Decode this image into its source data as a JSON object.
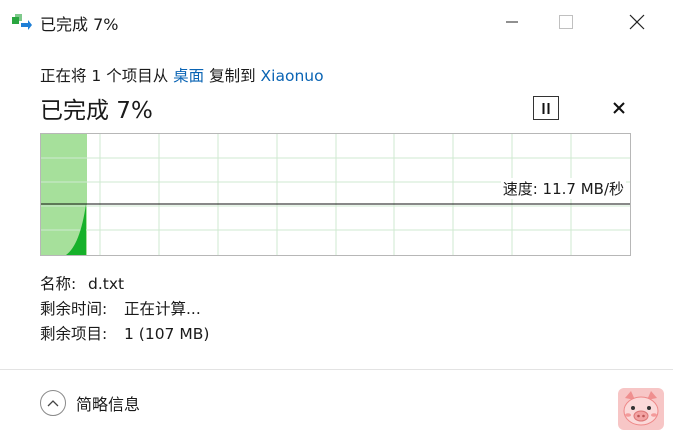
{
  "window": {
    "title": "已完成 7%",
    "icon": "copy-files-icon",
    "controls": [
      "minimize-icon",
      "maximize-icon",
      "close-icon"
    ]
  },
  "transfer": {
    "prefix": "正在将 1 个项目从 ",
    "source": "桌面",
    "middle": " 复制到 ",
    "destination": "Xiaonuo"
  },
  "status": {
    "headline": "已完成 7%",
    "progress_percent": 7
  },
  "actions": {
    "pause_icon": "pause-icon",
    "cancel_icon": "close-icon"
  },
  "chart_data": {
    "type": "area",
    "speed_label": "速度: 11.7 MB/秒",
    "progress_percent": 7
  },
  "details": {
    "name_label": "名称:",
    "name_value": "d.txt",
    "time_label": "剩余时间:",
    "time_value": "正在计算...",
    "items_label": "剩余项目:",
    "items_value": "1 (107 MB)"
  },
  "footer": {
    "toggle_label": "简略信息",
    "toggle_icon": "chevron-up-icon",
    "mascot_icon": "pig-face-icon"
  },
  "colors": {
    "link": "#0a64b4",
    "progress_fill": "#a6e09b",
    "speed_area": "#16b12a",
    "grid": "#cfead0"
  }
}
